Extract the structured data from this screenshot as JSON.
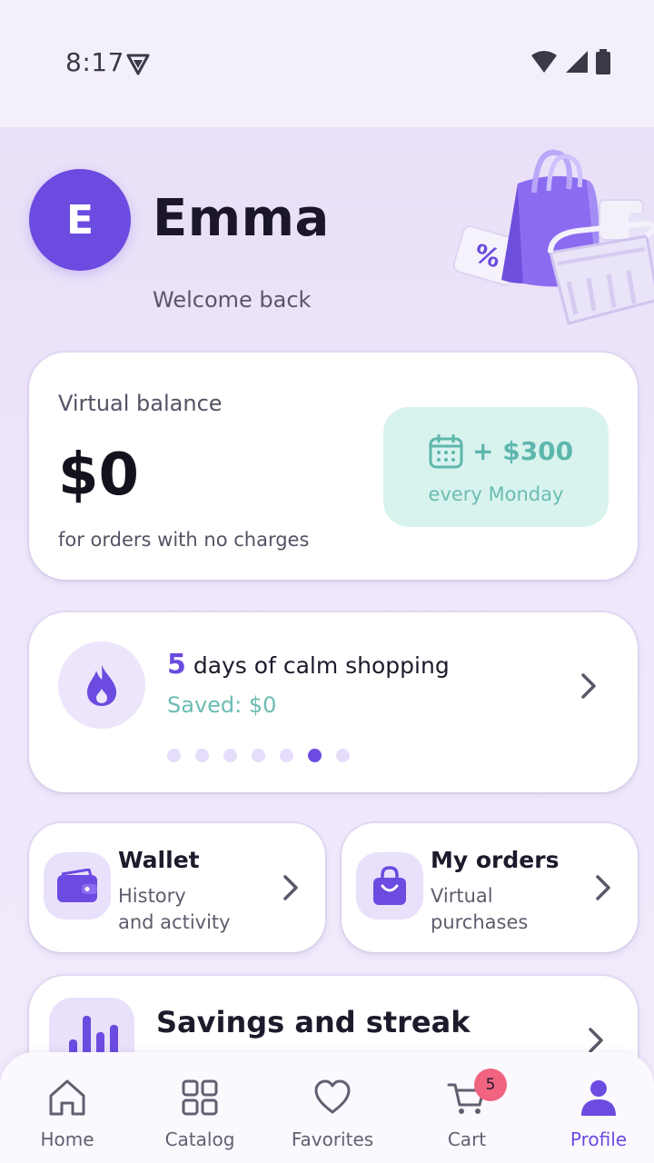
{
  "status_bar": {
    "time": "8:17"
  },
  "profile": {
    "initial": "E",
    "name": "Emma",
    "greeting": "Welcome back"
  },
  "balance": {
    "label": "Virtual balance",
    "value": "$0",
    "note": "for orders with no charges",
    "bonus_amount": "+ $300",
    "bonus_schedule": "every Monday"
  },
  "streak": {
    "count": "5",
    "title": " days of calm shopping",
    "saved": "Saved: $0",
    "dots_total": 7,
    "active_dot": 6
  },
  "wallet": {
    "title": "Wallet",
    "subtitle_line1": "History",
    "subtitle_line2": "and activity"
  },
  "orders": {
    "title": "My orders",
    "subtitle_line1": "Virtual",
    "subtitle_line2": "purchases"
  },
  "savings": {
    "title": "Savings and streak"
  },
  "nav": {
    "home": "Home",
    "catalog": "Catalog",
    "favorites": "Favorites",
    "cart": "Cart",
    "cart_badge": "5",
    "profile": "Profile"
  },
  "colors": {
    "accent": "#6b4be0",
    "teal": "#6cbcb2",
    "badge": "#f06480",
    "background": "#efe8fb"
  },
  "icons": {
    "status": [
      "vpn-shield-icon",
      "wifi-icon",
      "signal-icon",
      "battery-icon"
    ],
    "nav": [
      "home-icon",
      "catalog-icon",
      "heart-icon",
      "cart-icon",
      "person-icon"
    ],
    "cards": [
      "calendar-icon",
      "flame-icon",
      "wallet-icon",
      "bag-icon",
      "bar-chart-icon",
      "chevron-right-icon"
    ]
  }
}
